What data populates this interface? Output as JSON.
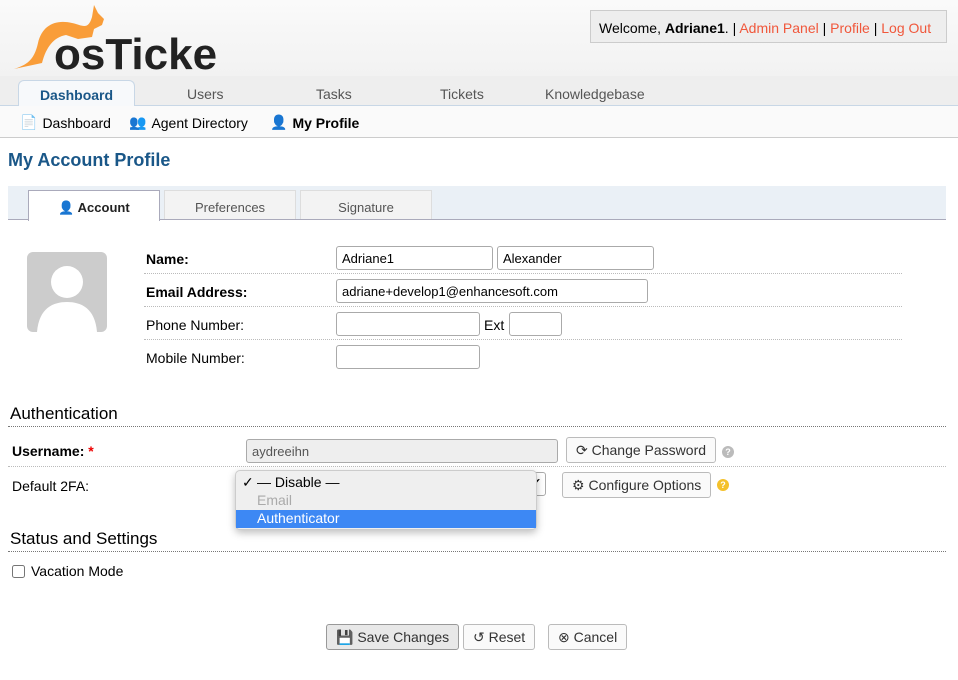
{
  "header": {
    "logo_text": "osTicket",
    "welcome_prefix": "Welcome, ",
    "user": "Adriane1",
    "links": [
      "Admin Panel",
      "Profile",
      "Log Out"
    ]
  },
  "nav": {
    "tabs": [
      "Dashboard",
      "Users",
      "Tasks",
      "Tickets",
      "Knowledgebase"
    ],
    "active": "Dashboard"
  },
  "subnav": [
    "Dashboard",
    "Agent Directory",
    "My Profile"
  ],
  "page_title": "My Account Profile",
  "profile_tabs": [
    "Account",
    "Preferences",
    "Signature"
  ],
  "account": {
    "name_label": "Name:",
    "first_name": "Adriane1",
    "last_name": "Alexander",
    "email_label": "Email Address:",
    "email": "adriane+develop1@enhancesoft.com",
    "phone_label": "Phone Number:",
    "phone": "",
    "ext_label": "Ext",
    "ext": "",
    "mobile_label": "Mobile Number:",
    "mobile": ""
  },
  "auth": {
    "title": "Authentication",
    "username_label": "Username:",
    "required": "*",
    "username": "aydreeihn",
    "change_password": "Change Password",
    "twofa_label": "Default 2FA:",
    "twofa_options": [
      "— Disable —",
      "Email",
      "Authenticator"
    ],
    "twofa_selected": "— Disable —",
    "twofa_highlighted": "Authenticator",
    "configure": "Configure Options"
  },
  "status": {
    "title": "Status and Settings",
    "vacation_label": "Vacation Mode",
    "vacation_checked": false
  },
  "actions": {
    "save": "Save Changes",
    "reset": "Reset",
    "cancel": "Cancel"
  },
  "colors": {
    "accent": "#1a5788",
    "link": "#f0573b",
    "logo": "#f99d39",
    "highlight": "#3d88f4"
  }
}
